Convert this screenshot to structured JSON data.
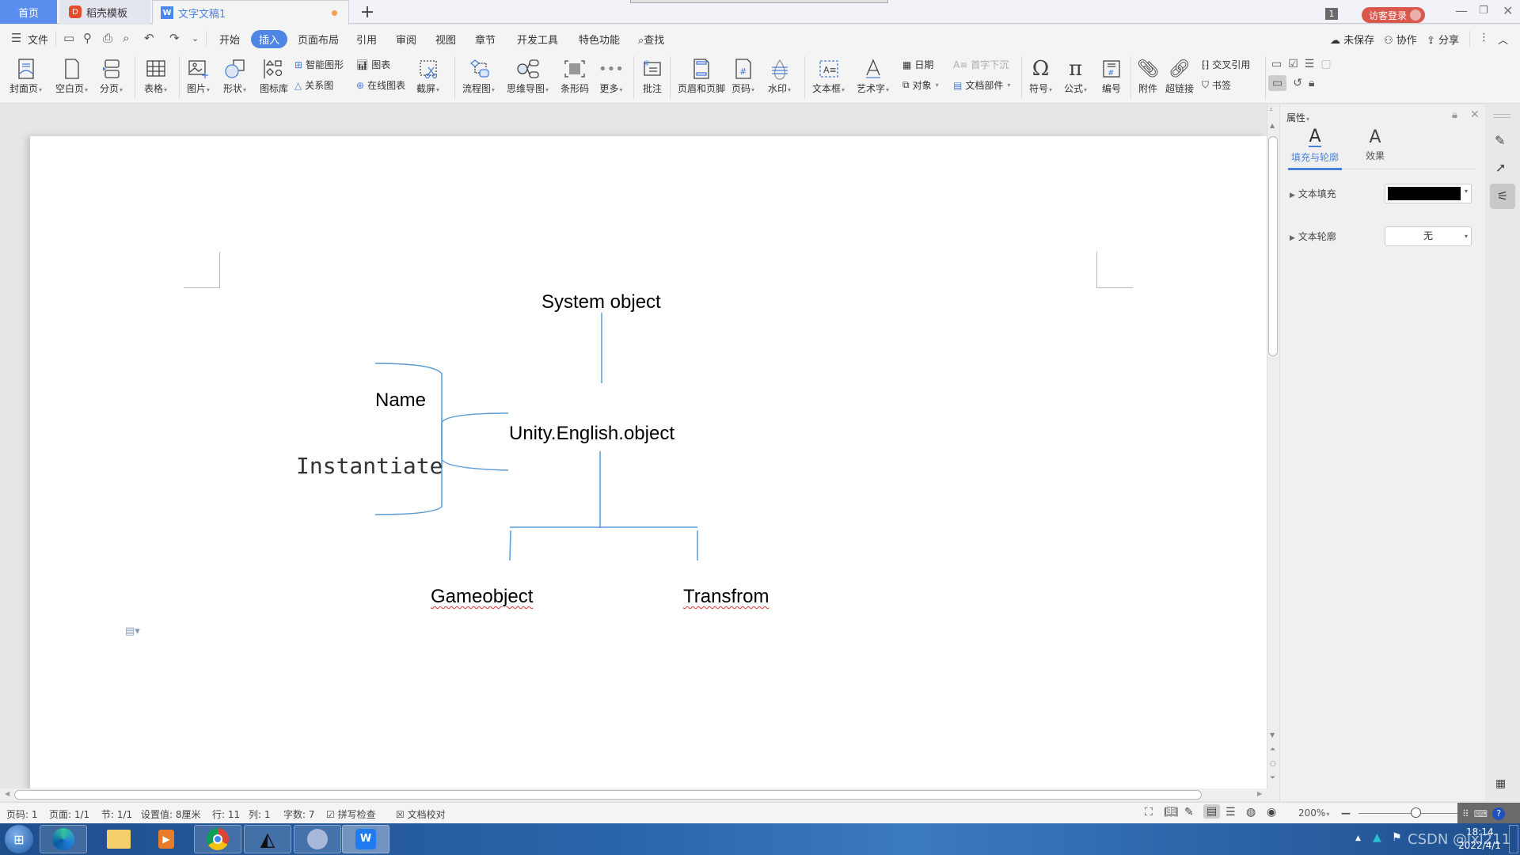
{
  "tabs": {
    "home": "首页",
    "template": "稻壳模板",
    "document": "文字文稿1",
    "new_tab": "+"
  },
  "titlebar": {
    "window_count": "1",
    "login": "访客登录"
  },
  "menu": {
    "file": "文件",
    "items": [
      "开始",
      "插入",
      "页面布局",
      "引用",
      "审阅",
      "视图",
      "章节",
      "开发工具",
      "特色功能"
    ],
    "active": "插入",
    "search": "查找",
    "unsaved": "未保存",
    "collab": "协作",
    "share": "分享"
  },
  "ribbon": {
    "cover": "封面页",
    "blank": "空白页",
    "pagebreak": "分页",
    "table": "表格",
    "picture": "图片",
    "shape": "形状",
    "iconlib": "图标库",
    "smartart": "智能图形",
    "relation": "关系图",
    "chart": "图表",
    "online_chart": "在线图表",
    "screenshot": "截屏",
    "flowchart": "流程图",
    "mindmap": "思维导图",
    "barcode": "条形码",
    "more": "更多",
    "comment": "批注",
    "header_footer": "页眉和页脚",
    "page_number": "页码",
    "watermark": "水印",
    "textbox": "文本框",
    "wordart": "艺术字",
    "date": "日期",
    "dropcap": "首字下沉",
    "object": "对象",
    "docpart": "文档部件",
    "symbol": "符号",
    "formula": "公式",
    "numbering": "编号",
    "attachment": "附件",
    "hyperlink": "超链接",
    "crossref": "交叉引用",
    "bookmark": "书签"
  },
  "document": {
    "nodes": {
      "system_object": "System object",
      "unity_object": "Unity.English.object",
      "name": "Name",
      "instantiate": "Instantiate",
      "gameobject": "Gameobject",
      "transform": "Transfrom"
    },
    "line_color": "#5b9bd5"
  },
  "properties": {
    "title": "属性",
    "tab_fill": "填充与轮廓",
    "tab_effect": "效果",
    "text_fill_label": "文本填充",
    "text_fill_color": "#000000",
    "text_outline_label": "文本轮廓",
    "text_outline_value": "无"
  },
  "status": {
    "page": "页码: 1",
    "pages": "页面: 1/1",
    "section": "节: 1/1",
    "setting": "设置值: 8厘米",
    "row": "行: 11",
    "col": "列: 1",
    "words": "字数: 7",
    "spell": "拼写检查",
    "proof": "文档校对",
    "zoom": "200%",
    "zoom_fraction": 0.55
  },
  "taskbar": {
    "time": "18:14",
    "date": "2022/4/1",
    "watermark": "CSDN @lxl211"
  }
}
